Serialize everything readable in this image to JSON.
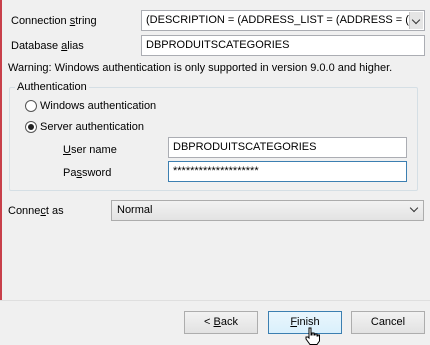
{
  "connection": {
    "string_label_pre": "Connection ",
    "string_label_u": "s",
    "string_label_post": "tring",
    "string_value": "(DESCRIPTION = (ADDRESS_LIST = (ADDRESS = (",
    "alias_label_pre": "Database ",
    "alias_label_u": "a",
    "alias_label_post": "lias",
    "alias_value": "DBPRODUITSCATEGORIES"
  },
  "warning": "Warning: Windows authentication is only supported in version 9.0.0 and higher.",
  "authentication": {
    "group_title": "Authentication",
    "windows_option": "Windows authentication",
    "server_option": "Server authentication",
    "selected": "server",
    "username_label_u": "U",
    "username_label_post": "ser name",
    "username_value": "DBPRODUITSCATEGORIES",
    "password_label_pre": "Pa",
    "password_label_u": "s",
    "password_label_post": "sword",
    "password_value": "********************"
  },
  "connect_as": {
    "label_pre": "Conne",
    "label_u": "c",
    "label_post": "t as",
    "value": "Normal"
  },
  "buttons": {
    "back_pre": "< ",
    "back_u": "B",
    "back_post": "ack",
    "finish_u": "F",
    "finish_post": "inish",
    "cancel": "Cancel"
  },
  "icons": {
    "dropdown": "chevron-down-icon",
    "cursor": "hand-pointer-icon"
  },
  "colors": {
    "accent_border": "#3c7fb1",
    "side_marker": "#c8404a"
  }
}
